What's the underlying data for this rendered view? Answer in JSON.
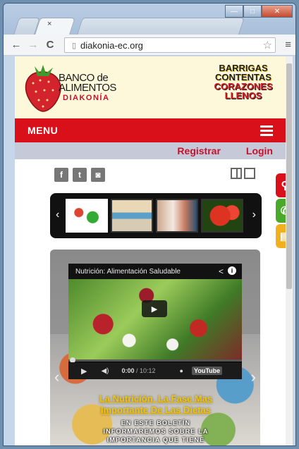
{
  "browser": {
    "tab_close": "×",
    "url": "diakonia-ec.org",
    "window_buttons": {
      "minimize": "—",
      "maximize": "□",
      "close": "✕"
    },
    "nav": {
      "back": "←",
      "forward": "→",
      "reload": "C"
    },
    "star": "☆",
    "menu": "≡"
  },
  "site": {
    "logo": {
      "line1": "BANCO de",
      "line2": "ALIMENTOS",
      "line3": "DIAKONÍA"
    },
    "slogan": {
      "line1": "BARRIGAS",
      "line2": "CONTENTAS",
      "line3": "CORAZONES",
      "line4": "LLENOS"
    },
    "menu_label": "MENU",
    "register": "Registrar",
    "login": "Login",
    "social": {
      "facebook": "f",
      "twitter": "t",
      "instagram": "◙"
    },
    "carousel": {
      "prev": "‹",
      "next": "›"
    },
    "side_icons": {
      "map": "⚲",
      "phone": "✆",
      "news": "▤"
    },
    "feature": {
      "video_title": "Nutrición: Alimentación Saludable",
      "time_current": "0:00",
      "time_total": " / 10:12",
      "youtube": "YouTube",
      "prev": "‹",
      "next": "›",
      "headline": "La Nutrición, La Fase Mas Importante De Las Dietas",
      "description": "EN ESTE BOLETÍN INFORMAREMOS SOBRE LA IMPORTANCIA QUE TIENE"
    }
  },
  "colors": {
    "brand_red": "#d9101a",
    "headline_yellow": "#f5c400",
    "header_bg": "#fdf8da"
  }
}
